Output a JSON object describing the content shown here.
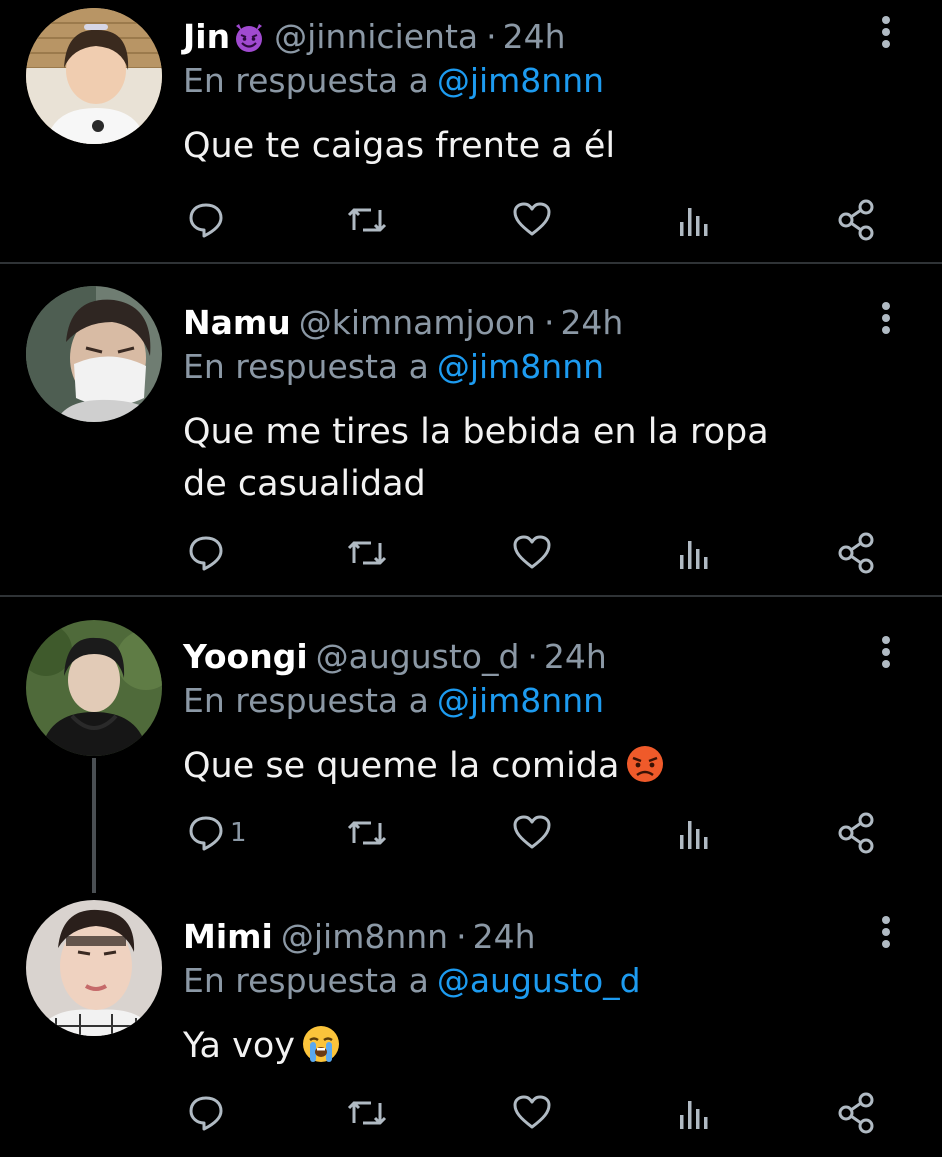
{
  "tweets": [
    {
      "name": "Jin",
      "name_emoji": "smiling-imp-emoji",
      "handle": "@jinnicienta",
      "separator": "·",
      "time": "24h",
      "reply_prefix": "En respuesta a",
      "reply_to": "@jim8nnn",
      "text": "Que te caigas frente a él",
      "text_emoji": "",
      "reply_count": ""
    },
    {
      "name": "Namu",
      "name_emoji": "",
      "handle": "@kimnamjoon",
      "separator": "·",
      "time": "24h",
      "reply_prefix": "En respuesta a",
      "reply_to": "@jim8nnn",
      "text": "Que me tires la bebida en la ropa de casualidad",
      "text_emoji": "",
      "reply_count": ""
    },
    {
      "name": "Yoongi",
      "name_emoji": "",
      "handle": "@augusto_d",
      "separator": "·",
      "time": "24h",
      "reply_prefix": "En respuesta a",
      "reply_to": "@jim8nnn",
      "text": "Que se queme la comida",
      "text_emoji": "angry-face-emoji",
      "reply_count": "1"
    },
    {
      "name": "Mimi",
      "name_emoji": "",
      "handle": "@jim8nnn",
      "separator": "·",
      "time": "24h",
      "reply_prefix": "En respuesta a",
      "reply_to": "@augusto_d",
      "text": "Ya voy",
      "text_emoji": "loudly-crying-face-emoji",
      "reply_count": ""
    }
  ],
  "icons": {
    "reply": "reply-icon",
    "retweet": "retweet-icon",
    "like": "heart-icon",
    "views": "views-icon",
    "share": "share-icon",
    "more": "more-options-icon"
  },
  "colors": {
    "background": "#000000",
    "muted": "#8b98a5",
    "mention": "#1d9bf0",
    "icon": "#b0bac3",
    "divider": "#2f3336"
  }
}
